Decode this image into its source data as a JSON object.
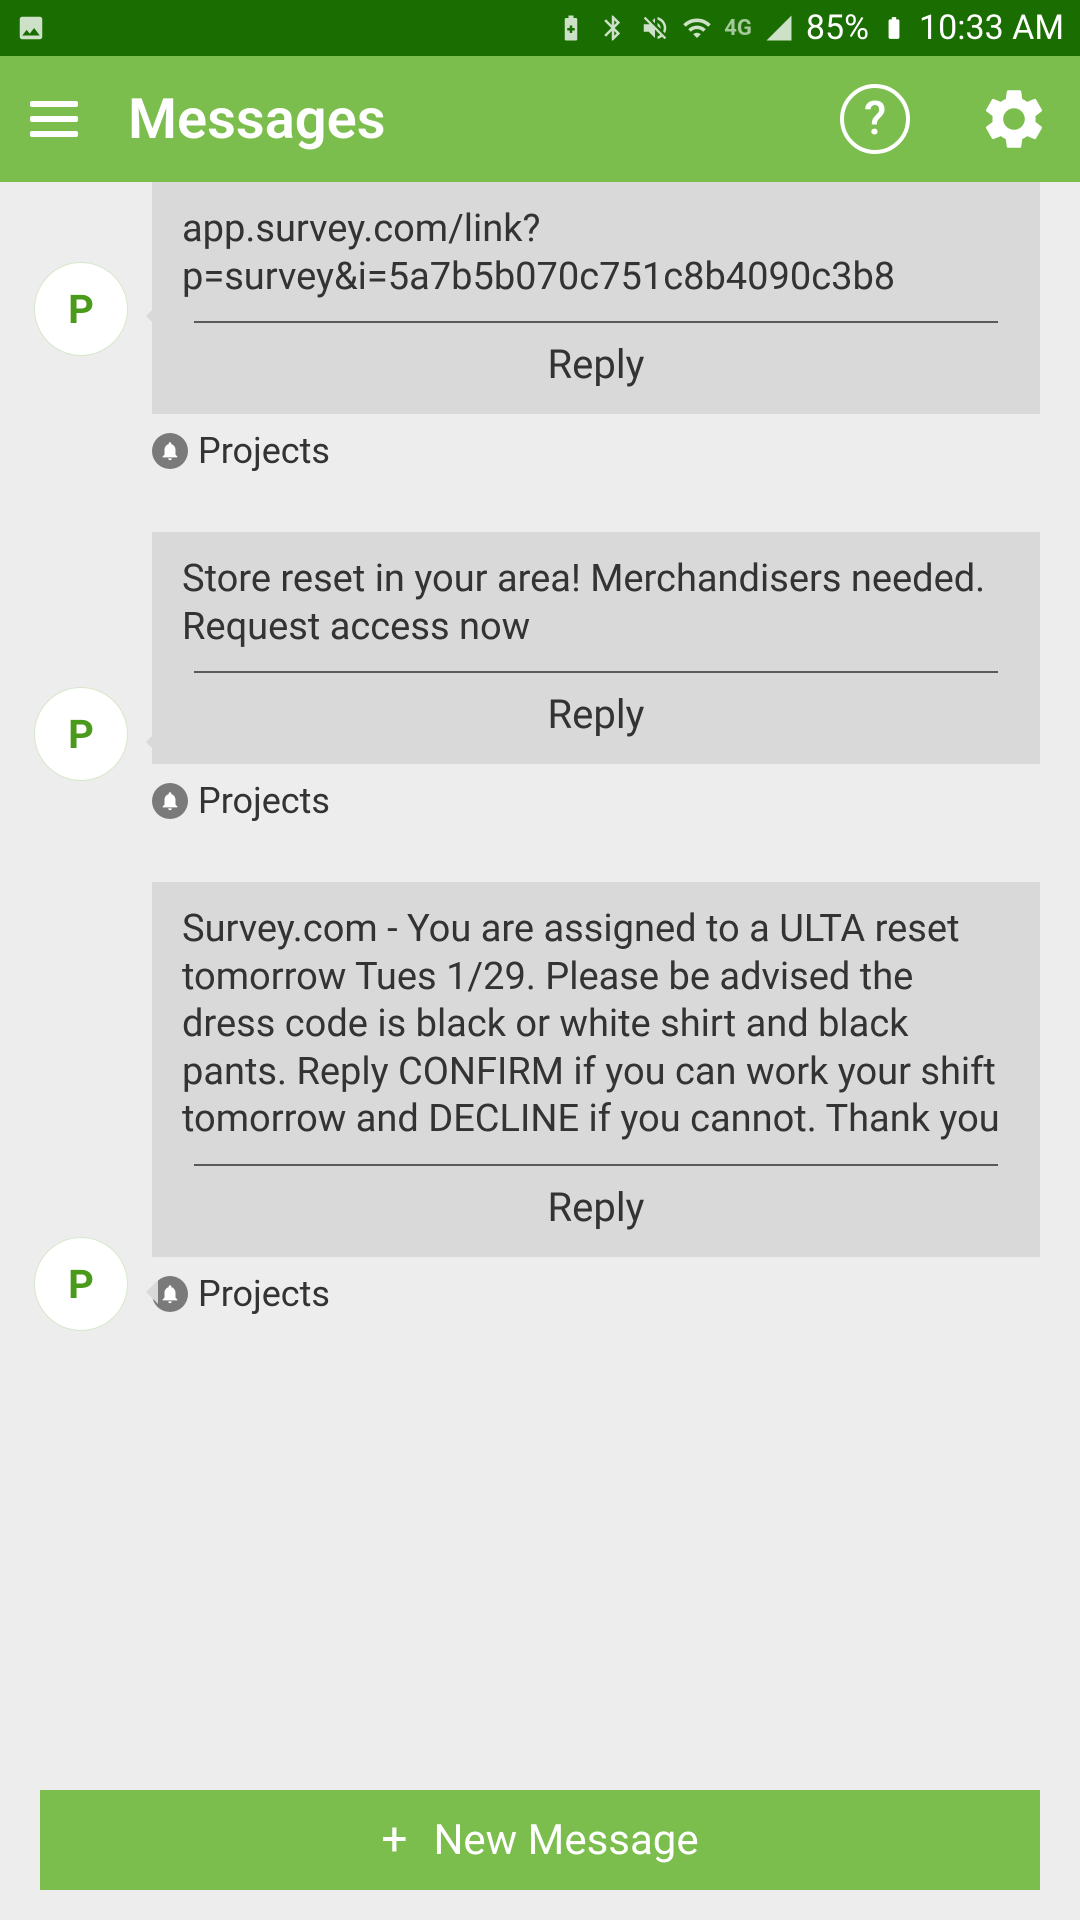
{
  "status": {
    "battery": "85%",
    "time": "10:33 AM",
    "network": "4G"
  },
  "app": {
    "title": "Messages",
    "help": "?",
    "new_message": "New Message"
  },
  "messages": [
    {
      "avatar": "P",
      "text": "app.survey.com/link?p=survey&i=5a7b5b070c751c8b4090c3b8",
      "reply": "Reply",
      "sender": "Projects"
    },
    {
      "avatar": "P",
      "text": "Store reset in your area! Merchandisers needed. Request access now",
      "reply": "Reply",
      "sender": "Projects"
    },
    {
      "avatar": "P",
      "text": "Survey.com - You are assigned to a ULTA  reset tomorrow Tues 1/29.  Please be advised the dress code is black or white shirt and black pants.  Reply CONFIRM if you can work your shift tomorrow and DECLINE if you cannot.  Thank you",
      "reply": "Reply",
      "sender": "Projects"
    }
  ]
}
